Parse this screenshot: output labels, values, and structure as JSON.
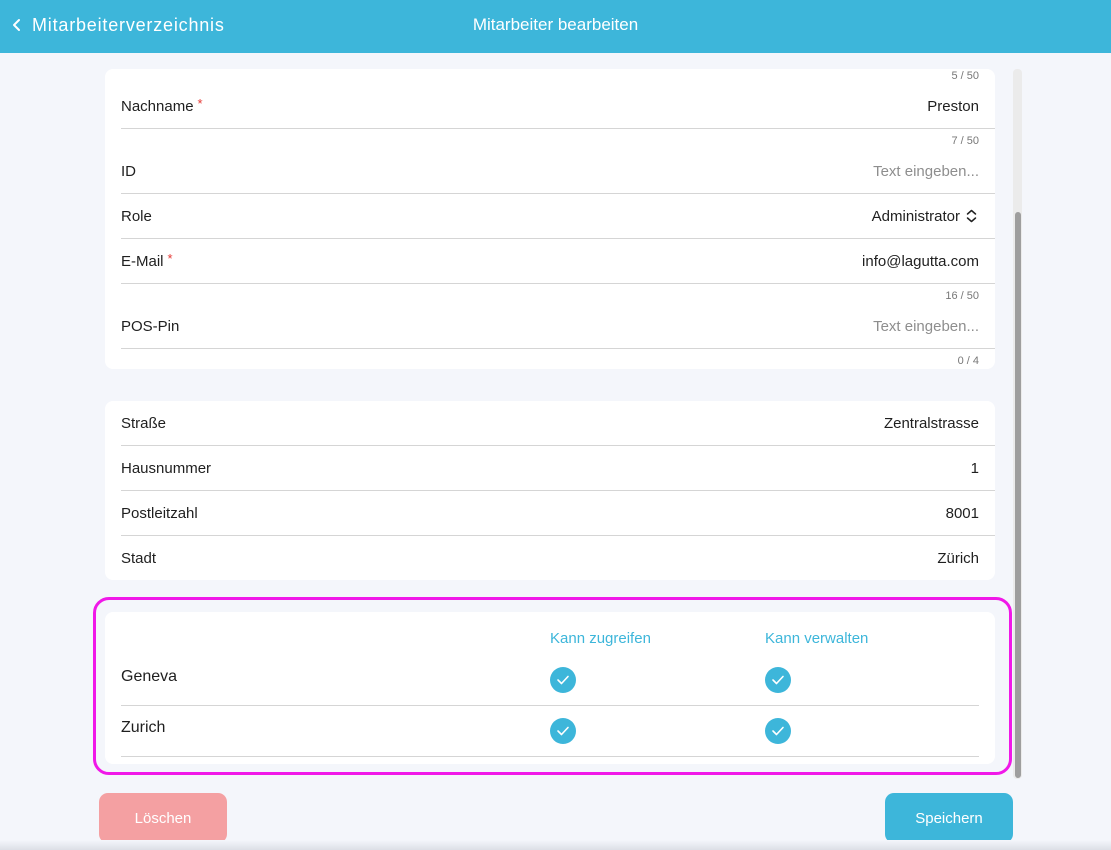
{
  "header": {
    "back_label": "Mitarbeiterverzeichnis",
    "title": "Mitarbeiter bearbeiten"
  },
  "personal": {
    "top_counter": "5 / 50",
    "lastname": {
      "label": "Nachname",
      "required_mark": "*",
      "value": "Preston",
      "counter": "7 / 50"
    },
    "id": {
      "label": "ID",
      "placeholder": "Text eingeben..."
    },
    "role": {
      "label": "Role",
      "value": "Administrator"
    },
    "email": {
      "label": "E-Mail",
      "required_mark": "*",
      "value": "info@lagutta.com",
      "counter": "16 / 50"
    },
    "pos_pin": {
      "label": "POS-Pin",
      "placeholder": "Text eingeben...",
      "counter": "0 / 4"
    }
  },
  "address": {
    "street": {
      "label": "Straße",
      "value": "Zentralstrasse"
    },
    "house_number": {
      "label": "Hausnummer",
      "value": "1"
    },
    "postal_code": {
      "label": "Postleitzahl",
      "value": "8001"
    },
    "city": {
      "label": "Stadt",
      "value": "Zürich"
    }
  },
  "locations": {
    "columns": {
      "access": "Kann zugreifen",
      "manage": "Kann verwalten"
    },
    "rows": [
      {
        "name": "Geneva",
        "can_access": true,
        "can_manage": true
      },
      {
        "name": "Zurich",
        "can_access": true,
        "can_manage": true
      }
    ]
  },
  "buttons": {
    "delete": "Löschen",
    "save": "Speichern"
  },
  "colors": {
    "accent": "#3db6da",
    "delete": "#f4a0a2",
    "highlight": "#f018e8",
    "required": "#e53935"
  },
  "icons": {
    "back": "chevron-left-icon",
    "select": "chevron-up-down-icon",
    "check": "check-circle-icon"
  }
}
